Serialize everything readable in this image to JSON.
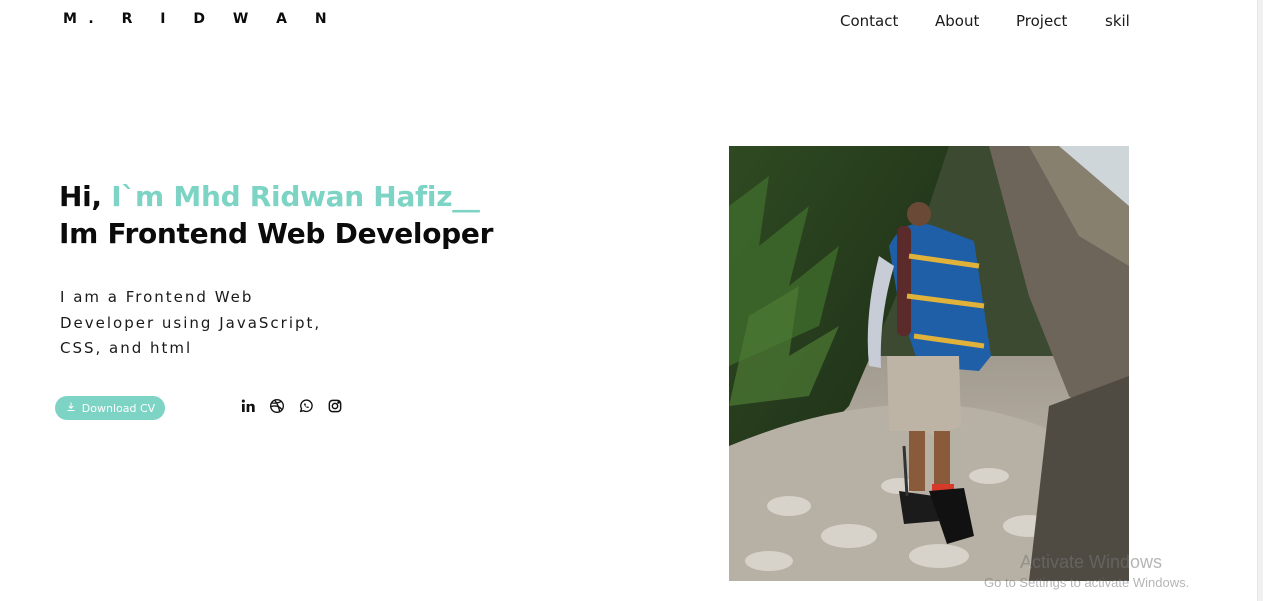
{
  "header": {
    "logo": "M. R I D W A N",
    "nav": [
      "Contact",
      "About",
      "Project",
      "skil"
    ]
  },
  "hero": {
    "greeting": "Hi,",
    "name": "I`m Mhd Ridwan Hafiz__",
    "role": "Im Frontend Web Developer",
    "intro_lines": [
      "I am a Frontend Web",
      "Developer using JavaScript,",
      "CSS, and html"
    ],
    "cv_button": {
      "label": "Download CV",
      "icon": "download-icon"
    },
    "socials": [
      "linkedin-icon",
      "dribbble-icon",
      "whatsapp-icon",
      "instagram-icon"
    ]
  },
  "photo": {
    "alt": "hiker with backpack on rocky trail"
  },
  "watermark": {
    "title": "Activate Windows",
    "subtitle": "Go to Settings to activate Windows."
  },
  "colors": {
    "accent": "#7dd3c4",
    "text": "#0b0b0b"
  }
}
